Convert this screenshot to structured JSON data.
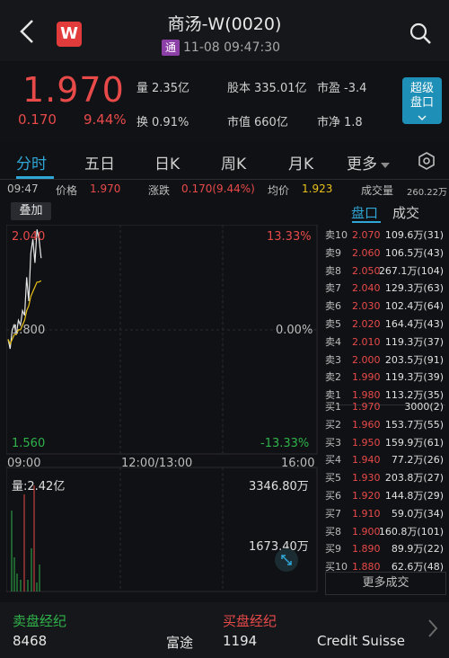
{
  "header": {
    "back_icon": "chevron-left-icon",
    "logo_text": "W",
    "title": "商汤-W(0020)",
    "tong_badge": "通",
    "datetime": "11-08 09:47:30",
    "search_icon": "search-icon"
  },
  "quote": {
    "price": "1.970",
    "change": "0.170",
    "change_pct": "9.44%",
    "stats": [
      {
        "key": "量",
        "value": "2.35亿"
      },
      {
        "key": "股本",
        "value": "335.01亿"
      },
      {
        "key": "市盈",
        "value": "-3.4"
      },
      {
        "key": "换",
        "value": "0.91%"
      },
      {
        "key": "市值",
        "value": "660亿"
      },
      {
        "key": "市净",
        "value": "1.8"
      }
    ],
    "super_button": {
      "line1": "超级",
      "line2": "盘口"
    }
  },
  "tabs": [
    "分时",
    "五日",
    "日K",
    "周K",
    "月K",
    "更多"
  ],
  "active_tab": "分时",
  "info_bar": {
    "time": "09:47",
    "price_label": "价格",
    "price": "1.970",
    "change_label": "涨跌",
    "change": "0.170(9.44%)",
    "avg_label": "均价",
    "avg": "1.923",
    "volume_label": "成交量",
    "volume": "260.22万"
  },
  "chart": {
    "overlay_button": "叠加",
    "y_high": "2.040",
    "y_mid": "1.800",
    "y_low": "1.560",
    "pct_high": "13.33%",
    "pct_mid": "0.00%",
    "pct_low": "-13.33%",
    "time_start": "09:00",
    "time_mid": "12:00/13:00",
    "time_end": "16:00",
    "vol_label": "量:2.42亿",
    "vol_max": "3346.80万",
    "vol_mid": "1673.40万",
    "colors": {
      "up": "#e84a4a",
      "down": "#2fb34a",
      "avg": "#e8c21c",
      "accent": "#30a6d6"
    }
  },
  "chart_data": {
    "type": "line",
    "series": [
      {
        "values": [
          1.8,
          1.78,
          1.82,
          1.83,
          1.81,
          1.84,
          1.83,
          1.86,
          1.85,
          1.93,
          1.88,
          1.98,
          2.01,
          1.96,
          2.03,
          2.01,
          1.97
        ]
      },
      {
        "values": [
          1.8,
          1.79,
          1.8,
          1.81,
          1.81,
          1.82,
          1.82,
          1.83,
          1.84,
          1.86,
          1.87,
          1.89,
          1.9,
          1.91,
          1.92,
          1.92,
          1.923
        ]
      }
    ],
    "ylim": [
      1.56,
      2.04
    ]
  },
  "orderbook": {
    "tabs": [
      "盘口",
      "成交"
    ],
    "asks": [
      {
        "label": "卖10",
        "price": "2.070",
        "vol": "109.6万(31)"
      },
      {
        "label": "卖9",
        "price": "2.060",
        "vol": "106.5万(43)"
      },
      {
        "label": "卖8",
        "price": "2.050",
        "vol": "267.1万(104)"
      },
      {
        "label": "卖7",
        "price": "2.040",
        "vol": "129.3万(63)"
      },
      {
        "label": "卖6",
        "price": "2.030",
        "vol": "102.4万(64)"
      },
      {
        "label": "卖5",
        "price": "2.020",
        "vol": "164.4万(43)"
      },
      {
        "label": "卖4",
        "price": "2.010",
        "vol": "119.3万(37)"
      },
      {
        "label": "卖3",
        "price": "2.000",
        "vol": "203.5万(91)"
      },
      {
        "label": "卖2",
        "price": "1.990",
        "vol": "119.3万(39)"
      },
      {
        "label": "卖1",
        "price": "1.980",
        "vol": "113.2万(35)"
      }
    ],
    "bids": [
      {
        "label": "买1",
        "price": "1.970",
        "vol": "3000(2)"
      },
      {
        "label": "买2",
        "price": "1.960",
        "vol": "153.7万(55)"
      },
      {
        "label": "买3",
        "price": "1.950",
        "vol": "159.9万(61)"
      },
      {
        "label": "买4",
        "price": "1.940",
        "vol": "77.2万(26)"
      },
      {
        "label": "买5",
        "price": "1.930",
        "vol": "203.8万(27)"
      },
      {
        "label": "买6",
        "price": "1.920",
        "vol": "144.8万(29)"
      },
      {
        "label": "买7",
        "price": "1.910",
        "vol": "59.0万(34)"
      },
      {
        "label": "买8",
        "price": "1.900",
        "vol": "160.8万(101)"
      },
      {
        "label": "买9",
        "price": "1.890",
        "vol": "89.9万(22)"
      },
      {
        "label": "买10",
        "price": "1.880",
        "vol": "62.6万(48)"
      }
    ],
    "more_button": "更多成交"
  },
  "brokers": {
    "sell_title": "卖盘经纪",
    "buy_title": "买盘经纪",
    "sell_code": "8468",
    "sell_name": "富途",
    "buy_code": "1194",
    "buy_name": "Credit Suisse"
  }
}
